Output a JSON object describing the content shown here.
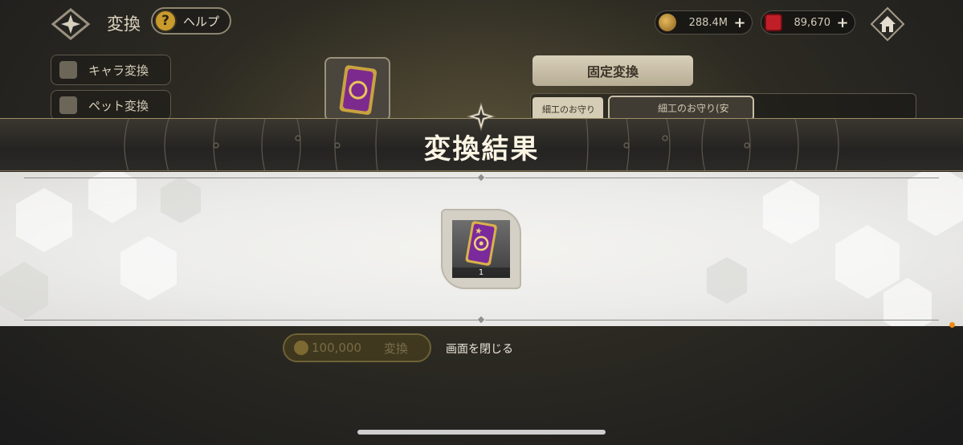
{
  "header": {
    "title": "変換",
    "help_icon_glyph": "?",
    "help_label": "ヘルプ",
    "gold_value": "288.4M",
    "gem_value": "89,670",
    "plus_glyph": "+"
  },
  "sidebar": {
    "tabs": [
      {
        "label": "キャラ変換",
        "icon": "character-icon"
      },
      {
        "label": "ペット変換",
        "icon": "pet-icon"
      }
    ]
  },
  "main": {
    "fixed_convert_label": "固定変換",
    "list_tag": "細工のお守り",
    "list_entry_label": "細工のお守り(安",
    "cost_value": "100,000",
    "convert_label": "変換"
  },
  "modal": {
    "title": "変換結果",
    "reward": {
      "icon": "charm-card-icon",
      "count": "1"
    },
    "close_label": "画面を閉じる"
  },
  "colors": {
    "accent_gold": "#c99a2c",
    "gem_red": "#c01f27",
    "banner_dark": "#242321",
    "panel_light": "#ececea",
    "notice_orange": "#f08a16"
  }
}
